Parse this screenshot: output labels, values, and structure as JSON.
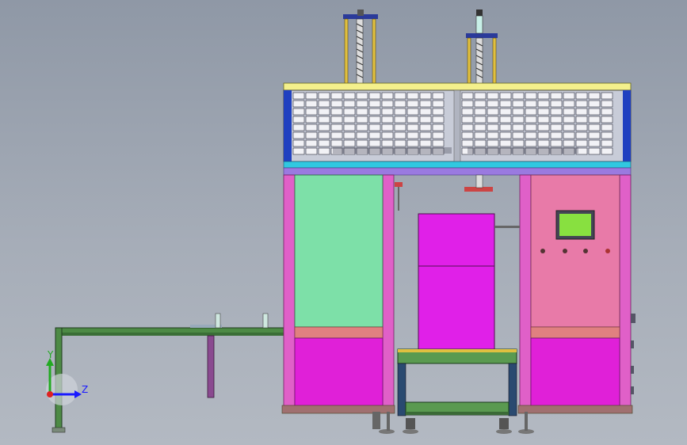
{
  "viewport": {
    "background_top": "#8f98a6",
    "background_bottom": "#b3b9c2"
  },
  "triad": {
    "y_label": "Y",
    "z_label": "Z",
    "y_color": "#22aa22",
    "z_color": "#1a1aff",
    "x_color": "#dd2222"
  },
  "model": {
    "frame_pink": "#e060c8",
    "frame_dark": "#c040a8",
    "panel_green": "#7de0a8",
    "panel_pink": "#e87aa8",
    "panel_magenta": "#e020d8",
    "salmon_band": "#e08080",
    "top_plate": "#f4f08c",
    "cyan_strip": "#30c8e0",
    "violet_strip": "#9a7ae0",
    "mesh_blue": "#2040c0",
    "hmi_screen": "#88e040",
    "conveyor_green": "#5a9a50"
  }
}
